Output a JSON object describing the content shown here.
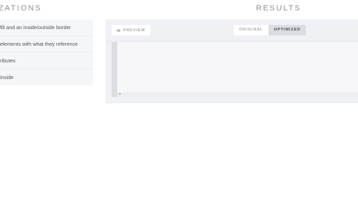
{
  "optimizations": {
    "heading": "ZATIONS",
    "items": [
      {
        "label": "fill and an inside/outside border"
      },
      {
        "label": "elements with what they reference"
      },
      {
        "label": "ributes"
      },
      {
        "label": "inside"
      }
    ]
  },
  "results": {
    "heading": "RESULTS",
    "preview_label": "PREVIEW",
    "preview_icon": "eye-icon",
    "tabs": [
      {
        "label": "ORIGINAL",
        "active": false
      },
      {
        "label": "OPTIMIZED",
        "active": true
      }
    ],
    "scroll_arrow": "◂"
  },
  "colors": {
    "background": "#ffffff",
    "panel": "#f0f1f4",
    "list_bg": "#f5f6f8",
    "active_tab": "#dcdde2",
    "text": "#4a4d57",
    "muted": "#8a8d97"
  }
}
